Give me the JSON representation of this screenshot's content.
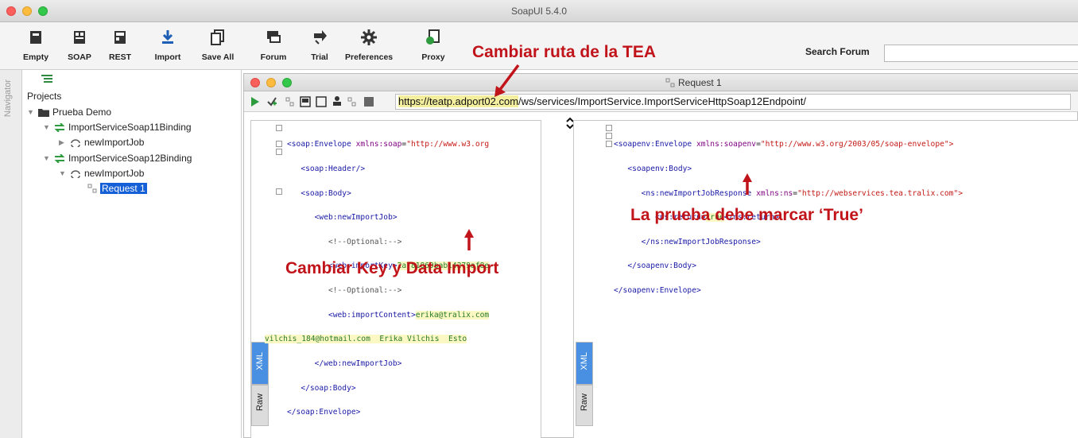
{
  "window": {
    "title": "SoapUI 5.4.0"
  },
  "toolbar": {
    "buttons": [
      {
        "label": "Empty"
      },
      {
        "label": "SOAP"
      },
      {
        "label": "REST"
      },
      {
        "label": "Import"
      },
      {
        "label": "Save All"
      },
      {
        "label": "Forum"
      },
      {
        "label": "Trial"
      },
      {
        "label": "Preferences"
      },
      {
        "label": "Proxy"
      }
    ],
    "search_label": "Search Forum",
    "search_value": ""
  },
  "navigator": {
    "label": "Navigator"
  },
  "tree": {
    "root_label": "Projects",
    "items": [
      {
        "label": "Prueba Demo"
      },
      {
        "label": "ImportServiceSoap11Binding"
      },
      {
        "label": "newImportJob"
      },
      {
        "label": "ImportServiceSoap12Binding"
      },
      {
        "label": "newImportJob"
      },
      {
        "label": "Request 1"
      }
    ]
  },
  "request": {
    "title": "Request 1",
    "url_highlight": "https://teatp.adport02.com",
    "url_rest": "/ws/services/ImportService.ImportServiceHttpSoap12Endpoint/",
    "left_tabs": {
      "xml": "XML",
      "raw": "Raw"
    },
    "right_tabs": {
      "xml": "XML",
      "raw": "Raw"
    }
  },
  "request_xml": {
    "l1a": "<soap:Envelope ",
    "l1b": "xmlns:soap",
    "l1c": "=",
    "l1d": "\"http://www.w3.org",
    "l2": "<soap:Header/>",
    "l3": "<soap:Body>",
    "l4": "<web:newImportJob>",
    "l5": "<!--Optional:-->",
    "l6a": "<web:importKey>",
    "l6b": "2a781869bab14279af8e",
    "l7": "<!--Optional:-->",
    "l8a": "<web:importContent>",
    "l8b": "erika@tralix.com",
    "l9": "vilchis_184@hotmail.com  Erika Vilchis  Esto",
    "l10": "</web:newImportJob>",
    "l11": "</soap:Body>",
    "l12": "</soap:Envelope>"
  },
  "response_xml": {
    "l1a": "<soapenv:Envelope ",
    "l1b": "xmlns:soapenv",
    "l1c": "=",
    "l1d": "\"http://www.w3.org/2003/05/soap-envelope\">",
    "l2": "<soapenv:Body>",
    "l3a": "<ns:newImportJobResponse ",
    "l3b": "xmlns:ns",
    "l3c": "=",
    "l3d": "\"http://webservices.tea.tralix.com\">",
    "l4a": "<ns:return>",
    "l4b": "true",
    "l4c": "</ns:return>",
    "l5": "</ns:newImportJobResponse>",
    "l6": "</soapenv:Body>",
    "l7": "</soapenv:Envelope>"
  },
  "annotations": {
    "url": "Cambiar ruta de la TEA",
    "key": "Cambiar Key y Data Import",
    "result": "La prueba debe marcar ‘True’"
  },
  "colors": {
    "annotation": "#c1141a",
    "selection": "#1560d6",
    "xml_tab": "#4a90e2"
  }
}
